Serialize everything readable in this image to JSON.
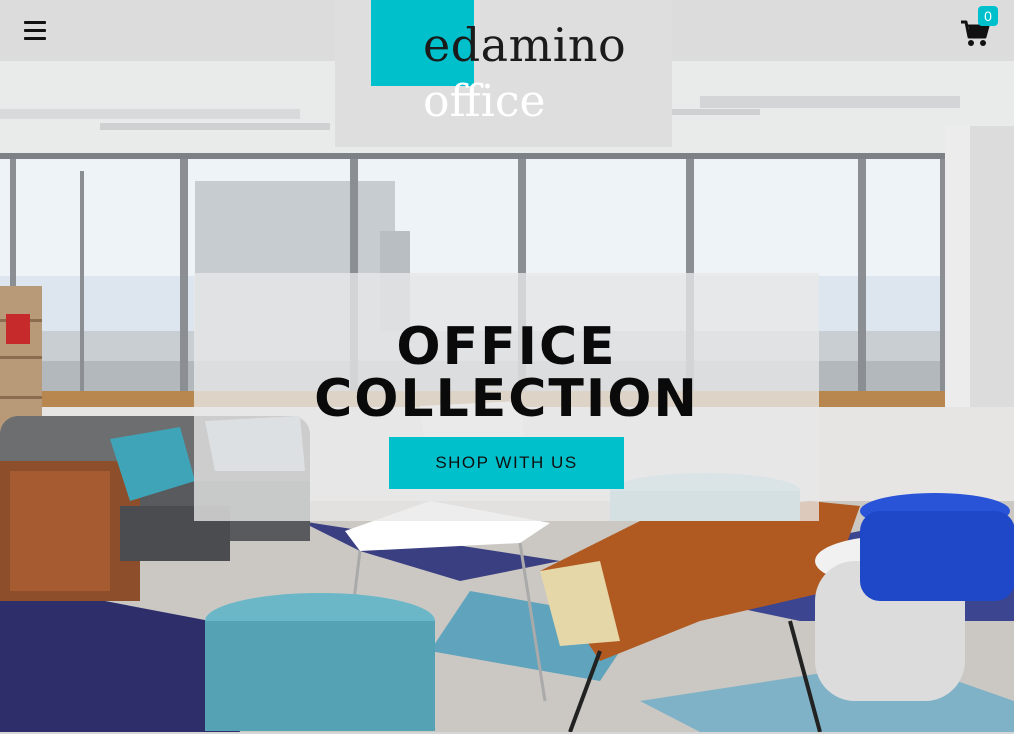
{
  "header": {
    "menu_icon": "hamburger-menu-icon",
    "cart_icon": "shopping-cart-icon",
    "cart_count": "0"
  },
  "logo": {
    "word": "edamino",
    "sub": "office"
  },
  "hero": {
    "headline": "OFFICE COLLECTION",
    "cta_label": "SHOP WITH US"
  },
  "colors": {
    "accent": "#00c0cc",
    "header_bg": "#dcdcdc",
    "text": "#0a0a0a"
  }
}
